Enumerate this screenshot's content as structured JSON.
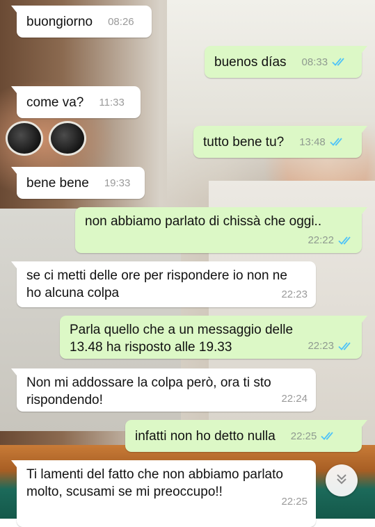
{
  "conversation": {
    "messages": [
      {
        "direction": "in",
        "text": "buongiorno",
        "time": "08:26"
      },
      {
        "direction": "out",
        "text": "buenos días",
        "time": "08:33",
        "status": "read"
      },
      {
        "direction": "in",
        "text": "come va?",
        "time": "11:33"
      },
      {
        "direction": "out",
        "text": "tutto bene tu?",
        "time": "13:48",
        "status": "read"
      },
      {
        "direction": "in",
        "text": "bene bene",
        "time": "19:33"
      },
      {
        "direction": "out",
        "text": "non abbiamo parlato di chissà che oggi..",
        "time": "22:22",
        "status": "read"
      },
      {
        "direction": "in",
        "text": "se ci metti delle ore per rispondere io non ne ho alcuna colpa",
        "time": "22:23"
      },
      {
        "direction": "out",
        "text": "Parla quello che a un messaggio delle 13.48 ha risposto alle 19.33",
        "time": "22:23",
        "status": "read"
      },
      {
        "direction": "in",
        "text": "Non mi addossare la colpa però, ora ti sto rispondendo!",
        "time": "22:24"
      },
      {
        "direction": "out",
        "text": "infatti non ho detto nulla",
        "time": "22:25",
        "status": "read"
      },
      {
        "direction": "in",
        "text": "Ti lamenti del fatto che non abbiamo parlato molto, scusami se mi preoccupo!!",
        "time": "22:25"
      }
    ]
  },
  "colors": {
    "incoming_bubble": "#ffffff",
    "outgoing_bubble": "#dcf8c6",
    "read_ticks": "#4fc3f7",
    "timestamp": "#8f9a90"
  },
  "icons": {
    "read_status": "double-check-icon",
    "scroll_down": "double-chevron-down-icon"
  }
}
